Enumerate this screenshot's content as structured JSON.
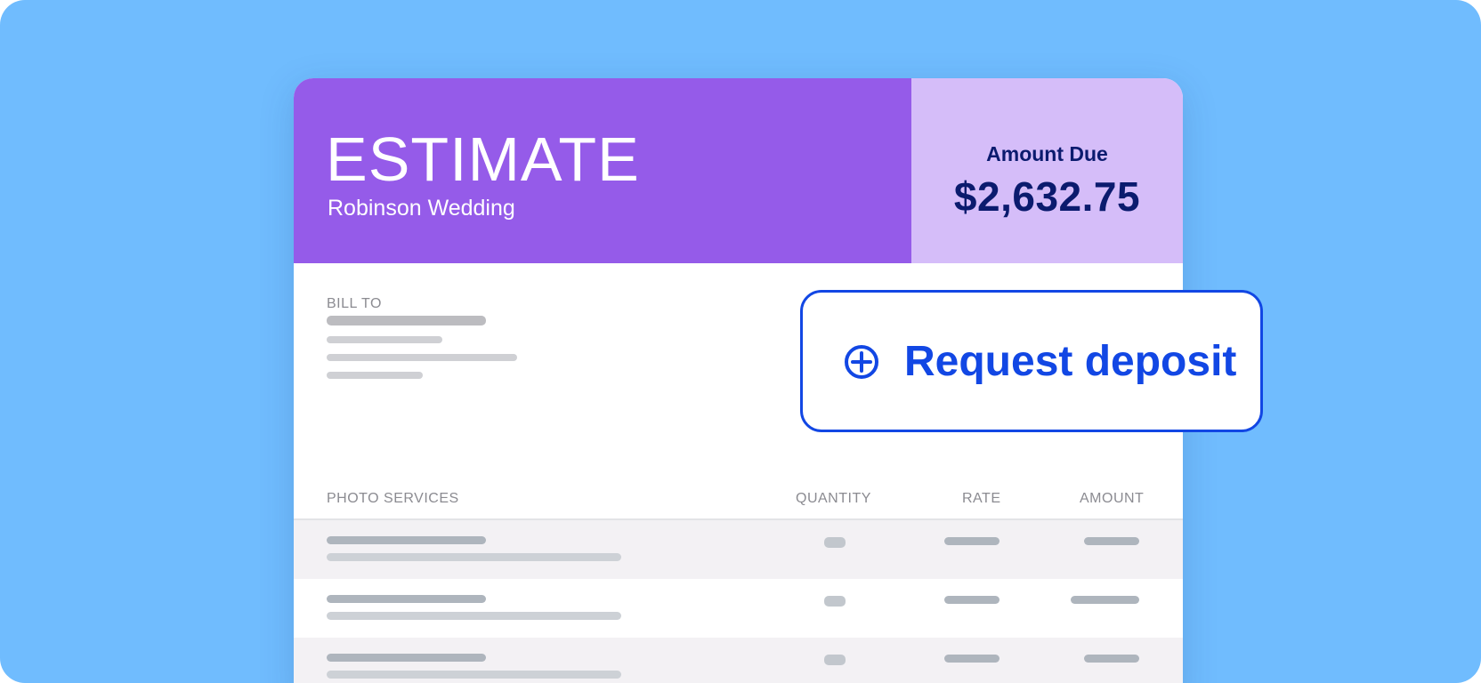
{
  "estimate": {
    "title": "ESTIMATE",
    "subtitle": "Robinson Wedding",
    "amount_due_label": "Amount Due",
    "amount_due_value": "$2,632.75",
    "bill_to_label": "BILL TO"
  },
  "table": {
    "columns": [
      "PHOTO SERVICES",
      "QUANTITY",
      "RATE",
      "AMOUNT"
    ],
    "row_count": 3
  },
  "deposit_button": {
    "label": "Request deposit",
    "icon": "plus-circle-icon"
  },
  "colors": {
    "background": "#70bcfe",
    "header_primary": "#955be9",
    "header_secondary": "#d5bdf9",
    "amount_text": "#0b1b6e",
    "accent_blue": "#1247e4"
  }
}
